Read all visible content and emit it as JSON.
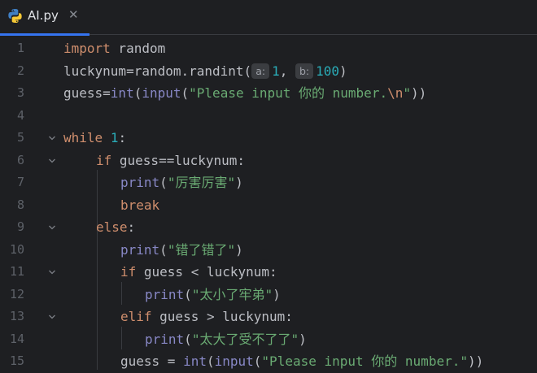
{
  "tab": {
    "label": "AI.py",
    "close_icon": "close-icon",
    "file_icon": "python-file-icon"
  },
  "colors": {
    "background": "#1e1f22",
    "keyword": "#cf8e6d",
    "builtin": "#8888c6",
    "number": "#2aacb8",
    "string": "#6aab73",
    "text": "#bcbec4",
    "line_number": "#5d6168",
    "tab_accent": "#3574f0"
  },
  "editor": {
    "line_numbers": [
      "1",
      "2",
      "3",
      "4",
      "5",
      "6",
      "7",
      "8",
      "9",
      "10",
      "11",
      "12",
      "13",
      "14",
      "15"
    ],
    "lines": [
      {
        "kw_import": "import",
        "rest": " random"
      },
      {
        "lhs": "luckynum=random.randint(",
        "hint_a": "a:",
        "arg_a": "1",
        "sep": ",",
        "hint_b": "b:",
        "arg_b": "100",
        "close": ")"
      },
      {
        "lhs": "guess=",
        "int": "int",
        "p1": "(",
        "input": "input",
        "p2": "(",
        "str": "\"Please input 你的 number.",
        "esc": "\\n",
        "str_end": "\"",
        "close": "))"
      },
      {},
      {
        "kw": "while",
        "sp": " ",
        "num": "1",
        "colon": ":"
      },
      {
        "kw": "if",
        "rest": " guess==luckynum:"
      },
      {
        "fn": "print",
        "p1": "(",
        "str": "\"厉害厉害\"",
        "p2": ")"
      },
      {
        "kw": "break"
      },
      {
        "kw": "else",
        "rest": ":"
      },
      {
        "fn": "print",
        "p1": "(",
        "str": "\"错了错了\"",
        "p2": ")"
      },
      {
        "kw": "if",
        "rest": " guess < luckynum:"
      },
      {
        "fn": "print",
        "p1": "(",
        "str": "\"太小了牢弟\"",
        "p2": ")"
      },
      {
        "kw": "elif",
        "rest": " guess > luckynum:"
      },
      {
        "fn": "print",
        "p1": "(",
        "str": "\"太大了受不了了\"",
        "p2": ")"
      },
      {
        "lhs": "guess = ",
        "int": "int",
        "p1": "(",
        "input": "input",
        "p2": "(",
        "str": "\"Please input 你的 number.\"",
        "close": "))"
      }
    ]
  }
}
